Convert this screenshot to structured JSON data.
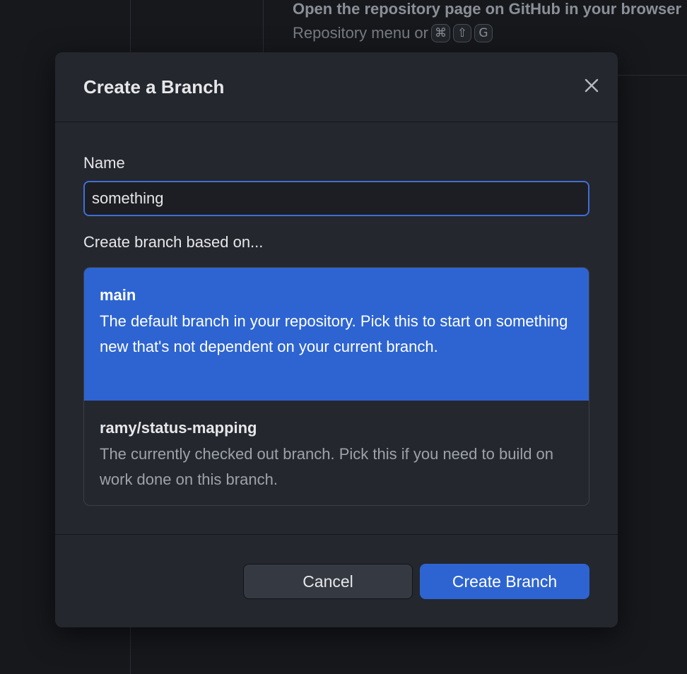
{
  "background": {
    "hint_title": "Open the repository page on GitHub in your browser",
    "hint_sub": "Repository menu or",
    "shortcut_keys": [
      "⌘",
      "⇧",
      "G"
    ]
  },
  "dialog": {
    "title": "Create a Branch",
    "close_icon": "close-icon",
    "name_label": "Name",
    "name_value": "something",
    "based_on_label": "Create branch based on...",
    "branches": [
      {
        "name": "main",
        "description": "The default branch in your repository. Pick this to start on something new that's not dependent on your current branch.",
        "selected": true
      },
      {
        "name": "ramy/status-mapping",
        "description": "The currently checked out branch. Pick this if you need to build on work done on this branch.",
        "selected": false
      }
    ],
    "cancel_label": "Cancel",
    "create_label": "Create Branch"
  },
  "colors": {
    "accent": "#2d64d1",
    "dialog_bg": "#24272e",
    "page_bg": "#16181c"
  }
}
